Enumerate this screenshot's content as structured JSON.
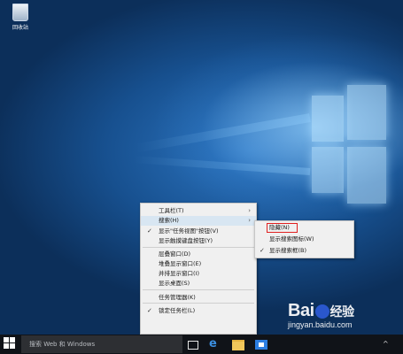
{
  "desktop": {
    "recycle_bin_label": "回收站"
  },
  "context_menu": {
    "items": [
      {
        "label": "工具栏(T)",
        "checked": false,
        "submenu": true
      },
      {
        "label": "搜索(H)",
        "checked": false,
        "submenu": true,
        "highlighted": true
      },
      {
        "label": "显示\"任务视图\"按钮(V)",
        "checked": true,
        "submenu": false
      },
      {
        "label": "显示触摸键盘按钮(Y)",
        "checked": false,
        "submenu": false
      },
      {
        "label": "层叠窗口(D)",
        "checked": false,
        "submenu": false
      },
      {
        "label": "堆叠显示窗口(E)",
        "checked": false,
        "submenu": false
      },
      {
        "label": "并排显示窗口(I)",
        "checked": false,
        "submenu": false
      },
      {
        "label": "显示桌面(S)",
        "checked": false,
        "submenu": false
      },
      {
        "label": "任务管理器(K)",
        "checked": false,
        "submenu": false
      },
      {
        "label": "锁定任务栏(L)",
        "checked": true,
        "submenu": false
      }
    ],
    "check_mark": "✓",
    "arrow": "›"
  },
  "search_submenu": {
    "items": [
      {
        "label": "隐藏(N)",
        "checked": false,
        "boxed": true
      },
      {
        "label": "显示搜索图标(W)",
        "checked": false
      },
      {
        "label": "显示搜索框(B)",
        "checked": true
      }
    ],
    "box_color": "#e02020"
  },
  "taskbar": {
    "search_placeholder": "搜索 Web 和 Windows",
    "tray_arrow": "^"
  },
  "watermark": {
    "brand_left": "Bai",
    "brand_right": "经验",
    "url": "jingyan.baidu.com"
  }
}
